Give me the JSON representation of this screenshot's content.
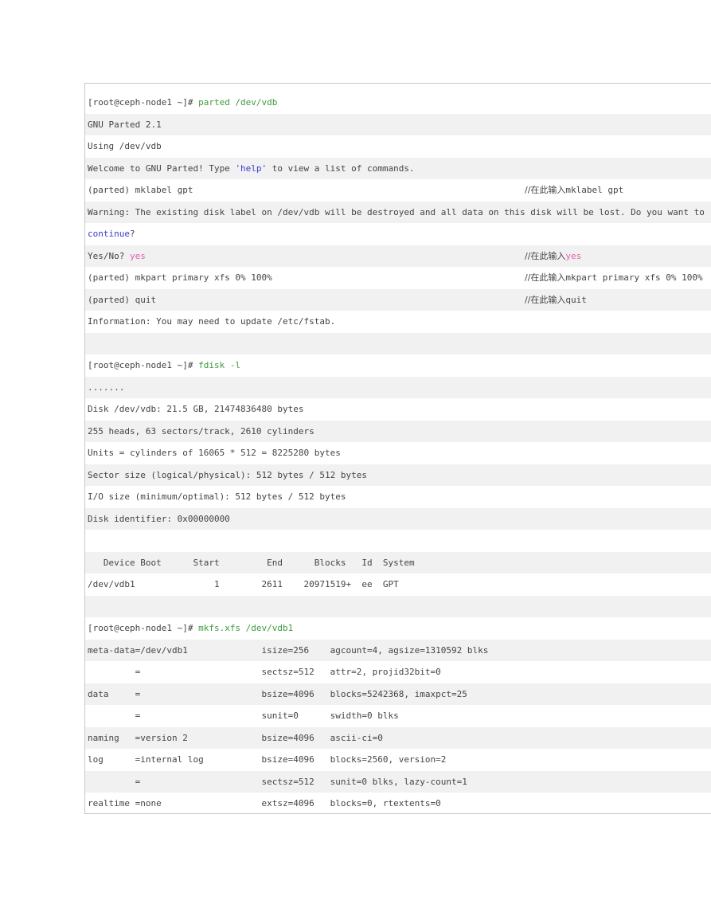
{
  "parted": {
    "prompt": "[root@ceph-node1 ~]# ",
    "command": "parted /dev/vdb",
    "version": "GNU Parted 2.1",
    "using": "Using /dev/vdb",
    "welcome_pre": "Welcome to GNU Parted! Type ",
    "welcome_help": "'help'",
    "welcome_post": " to view a list of commands.",
    "mklabel": "(parted) mklabel gpt",
    "mklabel_comment_label": "//在此输入",
    "mklabel_comment_cmd": "mklabel gpt",
    "warning": "Warning: The existing disk label on /dev/vdb will be destroyed and all data on this disk will be lost. Do you want to",
    "continue_word": "continue",
    "continue_q": "?",
    "yesno": "Yes/No? ",
    "yes": "yes",
    "yes_comment_label": "//在此输入",
    "yes_comment_cmd": "yes",
    "mkpart": "(parted) mkpart primary xfs 0% 100%",
    "mkpart_comment_label": "//在此输入",
    "mkpart_comment_cmd": "mkpart primary xfs 0% 100%",
    "quit": "(parted) quit",
    "quit_comment_label": "//在此输入",
    "quit_comment_cmd": "quit",
    "information": "Information: You may need to update /etc/fstab."
  },
  "fdisk": {
    "prompt": "[root@ceph-node1 ~]# ",
    "command": "fdisk -l",
    "ellipsis": ".......",
    "disk": "Disk /dev/vdb: 21.5 GB, 21474836480 bytes",
    "geometry": "255 heads, 63 sectors/track, 2610 cylinders",
    "units": "Units = cylinders of 16065 * 512 = 8225280 bytes",
    "sector_size": "Sector size (logical/physical): 512 bytes / 512 bytes",
    "io_size": "I/O size (minimum/optimal): 512 bytes / 512 bytes",
    "identifier": "Disk identifier: 0x00000000",
    "table_header": "   Device Boot      Start         End      Blocks   Id  System",
    "table_row": "/dev/vdb1               1        2611    20971519+  ee  GPT"
  },
  "mkfs": {
    "prompt": "[root@ceph-node1 ~]# ",
    "command": "mkfs.xfs /dev/vdb1",
    "lines": [
      "meta-data=/dev/vdb1              isize=256    agcount=4, agsize=1310592 blks",
      "         =                       sectsz=512   attr=2, projid32bit=0",
      "data     =                       bsize=4096   blocks=5242368, imaxpct=25",
      "         =                       sunit=0      swidth=0 blks",
      "naming   =version 2              bsize=4096   ascii-ci=0",
      "log      =internal log           bsize=4096   blocks=2560, version=2",
      "         =                       sectsz=512   sunit=0 blks, lazy-count=1",
      "realtime =none                   extsz=4096   blocks=0, rtextents=0"
    ]
  },
  "colors": {
    "command": "#3c9a3c",
    "keyword": "#3a3ad0",
    "answer": "#e060b0",
    "text": "#444444",
    "stripe": "#f1f1f1"
  }
}
